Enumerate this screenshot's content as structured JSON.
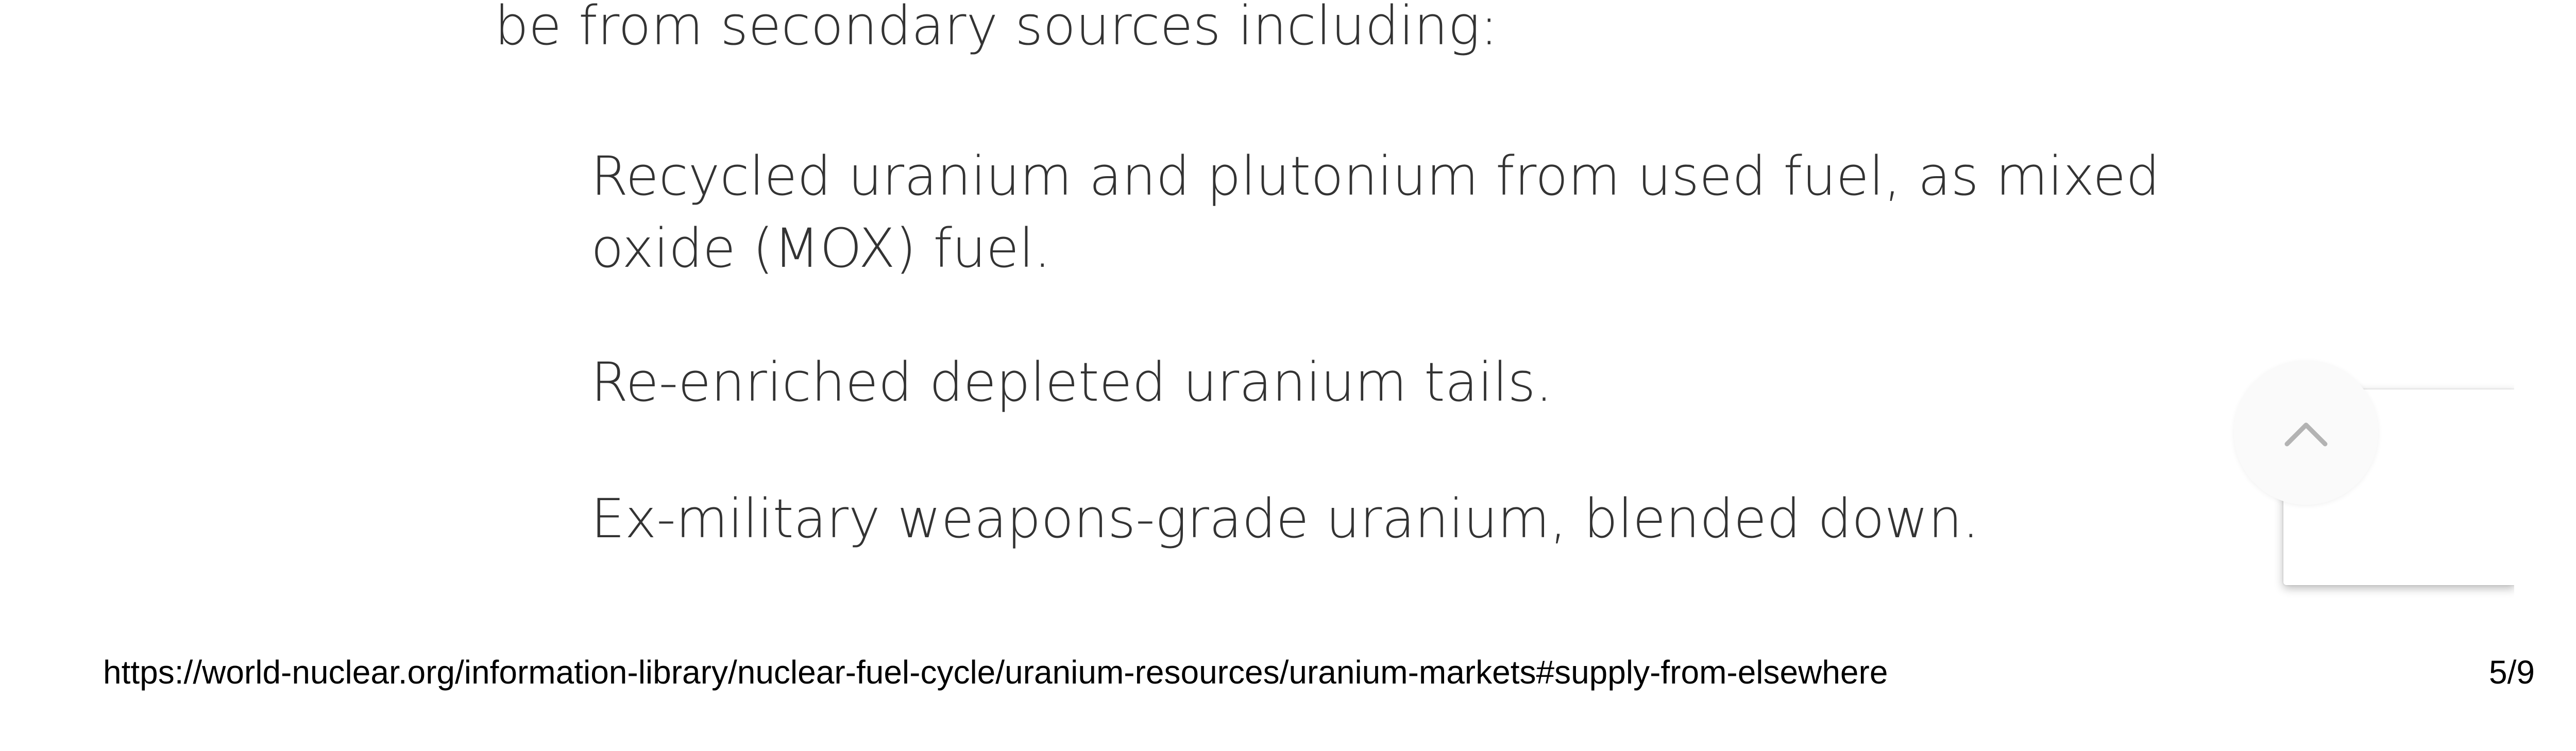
{
  "article": {
    "intro": "be from secondary sources including:",
    "sources": [
      "Recycled uranium and plutonium from used fuel, as mixed oxide (MOX) fuel.",
      "Re-enriched depleted uranium tails.",
      "Ex-military weapons-grade uranium, blended down."
    ]
  },
  "controls": {
    "back_to_top_icon": "chevron-up-icon",
    "icon_color": "#b3b3b3"
  },
  "footer": {
    "url": "https://world-nuclear.org/information-library/nuclear-fuel-cycle/uranium-resources/uranium-markets#supply-from-elsewhere",
    "page": "5/9"
  }
}
